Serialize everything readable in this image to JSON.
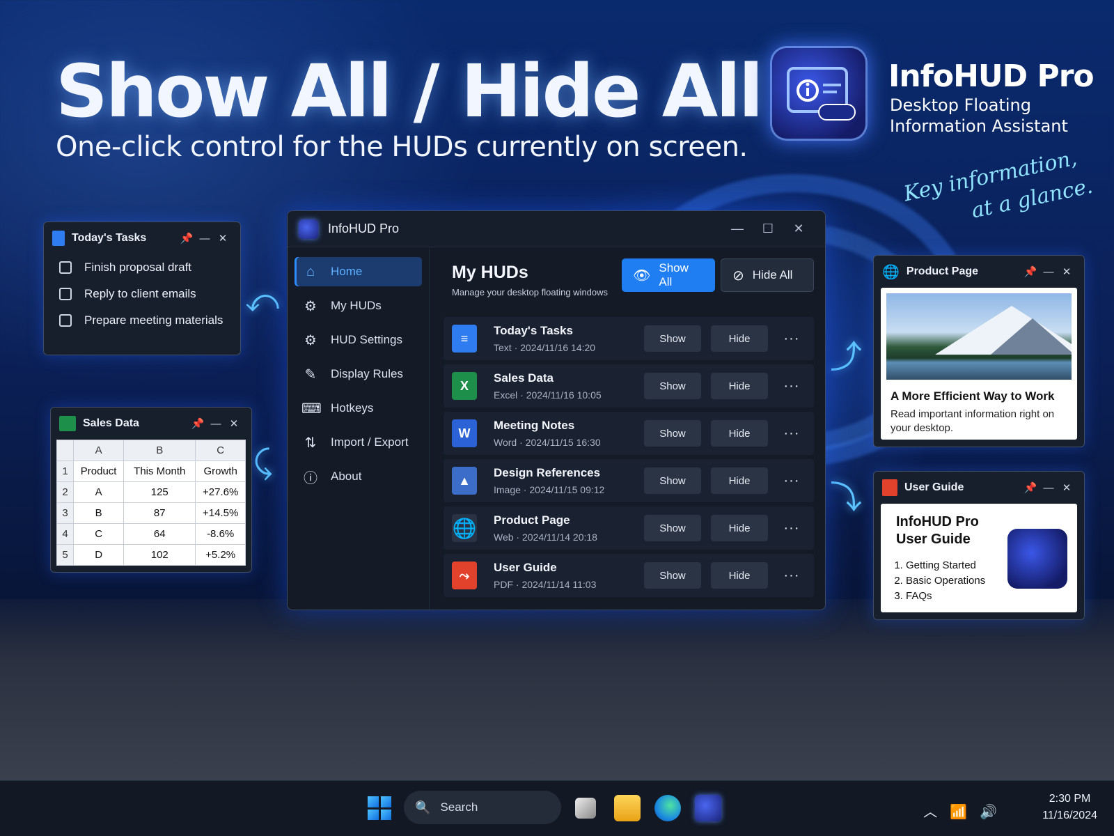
{
  "hero": {
    "headline": "Show All / Hide All",
    "subline": "One-click control for the HUDs currently on screen.",
    "brand_title": "InfoHUD Pro",
    "brand_sub_1": "Desktop Floating",
    "brand_sub_2": "Information Assistant",
    "tagline_1": "Key information,",
    "tagline_2": "at a glance."
  },
  "window": {
    "title": "InfoHUD Pro",
    "nav": [
      {
        "label": "Home",
        "icon": "home-icon",
        "active": true
      },
      {
        "label": "My HUDs",
        "icon": "gear-icon"
      },
      {
        "label": "HUD Settings",
        "icon": "gear-icon"
      },
      {
        "label": "Display Rules",
        "icon": "rule-icon"
      },
      {
        "label": "Hotkeys",
        "icon": "keyboard-icon"
      },
      {
        "label": "Import / Export",
        "icon": "sync-icon"
      },
      {
        "label": "About",
        "icon": "info-icon"
      }
    ],
    "content_title": "My HUDs",
    "content_subtitle": "Manage your desktop floating windows",
    "show_all_label": "Show All",
    "hide_all_label": "Hide All",
    "show_label": "Show",
    "hide_label": "Hide",
    "more_label": "···",
    "huds": [
      {
        "name": "Today's Tasks",
        "type": "Text",
        "date": "2024/11/16 14:20",
        "icon": "doc-icon",
        "color": "#2f7bf0"
      },
      {
        "name": "Sales Data",
        "type": "Excel",
        "date": "2024/11/16 10:05",
        "icon": "excel-icon",
        "color": "#1d8f4a"
      },
      {
        "name": "Meeting Notes",
        "type": "Word",
        "date": "2024/11/15 16:30",
        "icon": "word-icon",
        "color": "#2b62d6"
      },
      {
        "name": "Design References",
        "type": "Image",
        "date": "2024/11/15 09:12",
        "icon": "image-icon",
        "color": "#3c6ec9"
      },
      {
        "name": "Product Page",
        "type": "Web",
        "date": "2024/11/14 20:18",
        "icon": "globe-icon",
        "color": "#2a3344"
      },
      {
        "name": "User Guide",
        "type": "PDF",
        "date": "2024/11/14 11:03",
        "icon": "pdf-icon",
        "color": "#e2412c"
      }
    ]
  },
  "tasks_hud": {
    "title": "Today's Tasks",
    "items": [
      "Finish proposal draft",
      "Reply to client emails",
      "Prepare meeting materials"
    ]
  },
  "sales_hud": {
    "title": "Sales Data",
    "col_letters": [
      "A",
      "B",
      "C"
    ],
    "rows": [
      [
        "1",
        "Product",
        "This Month",
        "Growth"
      ],
      [
        "2",
        "A",
        "125",
        "+27.6%"
      ],
      [
        "3",
        "B",
        "87",
        "+14.5%"
      ],
      [
        "4",
        "C",
        "64",
        "-8.6%"
      ],
      [
        "5",
        "D",
        "102",
        "+5.2%"
      ]
    ]
  },
  "product_hud": {
    "title": "Product Page",
    "heading": "A More Efficient Way to Work",
    "text": "Read important information right on your desktop."
  },
  "guide_hud": {
    "title": "User Guide",
    "heading": "InfoHUD Pro User Guide",
    "items": [
      "Getting Started",
      "Basic Operations",
      "FAQs"
    ]
  },
  "taskbar": {
    "search_label": "Search",
    "time": "2:30 PM",
    "date": "11/16/2024"
  }
}
